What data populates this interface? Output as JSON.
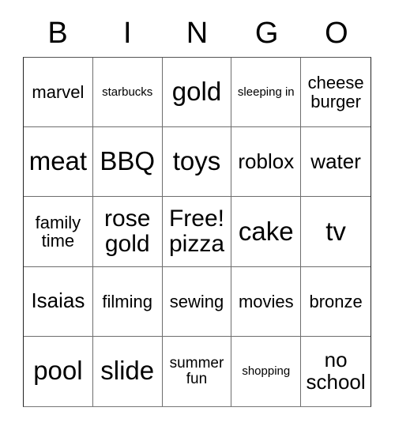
{
  "card": {
    "header_letters": [
      "B",
      "I",
      "N",
      "G",
      "O"
    ],
    "columns": 5,
    "rows": 5,
    "free_space_index": 12,
    "border_color": "#6e6e6e",
    "text_color": "#000000",
    "background_color": "#ffffff"
  },
  "cells": [
    {
      "text": "marvel",
      "size": "md"
    },
    {
      "text": "starbucks",
      "size": "xs"
    },
    {
      "text": "gold",
      "size": "xxl"
    },
    {
      "text": "sleeping in",
      "size": "xs"
    },
    {
      "text": "cheese burger",
      "size": "md"
    },
    {
      "text": "meat",
      "size": "xxl"
    },
    {
      "text": "BBQ",
      "size": "xxl"
    },
    {
      "text": "toys",
      "size": "xxl"
    },
    {
      "text": "roblox",
      "size": "lg"
    },
    {
      "text": "water",
      "size": "lg"
    },
    {
      "text": "family time",
      "size": "md"
    },
    {
      "text": "rose gold",
      "size": "xl"
    },
    {
      "text": "Free! pizza",
      "size": "xl"
    },
    {
      "text": "cake",
      "size": "xxl"
    },
    {
      "text": "tv",
      "size": "xxl"
    },
    {
      "text": "Isaias",
      "size": "lg"
    },
    {
      "text": "filming",
      "size": "md"
    },
    {
      "text": "sewing",
      "size": "md"
    },
    {
      "text": "movies",
      "size": "md"
    },
    {
      "text": "bronze",
      "size": "md"
    },
    {
      "text": "pool",
      "size": "xxl"
    },
    {
      "text": "slide",
      "size": "xxl"
    },
    {
      "text": "summer fun",
      "size": "sm"
    },
    {
      "text": "shopping",
      "size": "xs"
    },
    {
      "text": "no school",
      "size": "lg"
    }
  ]
}
